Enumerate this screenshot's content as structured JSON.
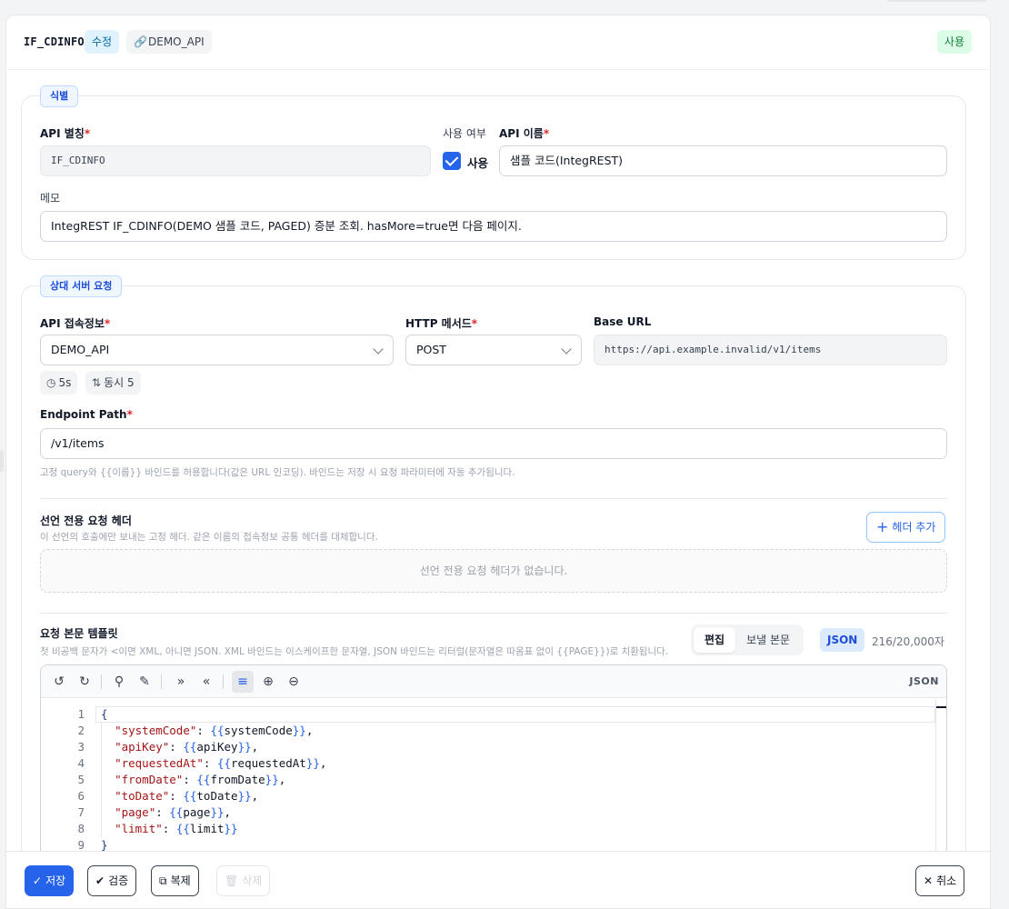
{
  "header": {
    "api_code": "IF_CDINFO",
    "mode_badge": "수정",
    "connection_badge": "DEMO_API",
    "status_badge": "사용"
  },
  "identify": {
    "tag": "식별",
    "alias_label": "API 별칭",
    "alias_value": "IF_CDINFO",
    "use_label": "사용 여부",
    "use_checkbox_label": "사용",
    "use_checked": true,
    "name_label": "API 이름",
    "name_value": "샘플 코드(IntegREST)",
    "memo_label": "메모",
    "memo_value": "IntegREST IF_CDINFO(DEMO 샘플 코드, PAGED) 증분 조회. hasMore=true면 다음 페이지."
  },
  "request": {
    "tag": "상대 서버 요청",
    "conn_label": "API 접속정보",
    "conn_value": "DEMO_API",
    "method_label": "HTTP 메서드",
    "method_value": "POST",
    "base_label": "Base URL",
    "base_value": "https://api.example.invalid/v1/items",
    "timeout_chip": "5s",
    "concurrency_chip": "동시 5",
    "endpoint_label": "Endpoint Path",
    "endpoint_value": "/v1/items",
    "endpoint_hint": "고정 query와 {{이름}} 바인드를 허용합니다(값은 URL 인코딩). 바인드는 저장 시 요청 파라미터에 자동 추가됩니다.",
    "headers_title": "선언 전용 요청 헤더",
    "headers_hint": "이 선언의 호출에만 보내는 고정 헤더. 같은 이름의 접속정보 공통 헤더를 대체합니다.",
    "add_header_label": "헤더 추가",
    "headers_empty": "선언 전용 요청 헤더가 없습니다.",
    "body_title": "요청 본문 템플릿",
    "body_hint": "첫 비공백 문자가 <이면 XML, 아니면 JSON. XML 바인드는 이스케이프한 문자열, JSON 바인드는 리터럴(문자열은 따옴표 없이 {{PAGE}})로 치환됩니다.",
    "tab_edit": "편집",
    "tab_preview": "보낼 본문",
    "format_pill": "JSON",
    "char_count": "216/20,000자",
    "editor_lang": "JSON"
  },
  "code_lines": [
    {
      "n": "1",
      "brace": "{"
    },
    {
      "n": "2",
      "key": "\"systemCode\"",
      "var": "systemCode",
      "comma": ","
    },
    {
      "n": "3",
      "key": "\"apiKey\"",
      "var": "apiKey",
      "comma": ","
    },
    {
      "n": "4",
      "key": "\"requestedAt\"",
      "var": "requestedAt",
      "comma": ","
    },
    {
      "n": "5",
      "key": "\"fromDate\"",
      "var": "fromDate",
      "comma": ","
    },
    {
      "n": "6",
      "key": "\"toDate\"",
      "var": "toDate",
      "comma": ","
    },
    {
      "n": "7",
      "key": "\"page\"",
      "var": "page",
      "comma": ","
    },
    {
      "n": "8",
      "key": "\"limit\"",
      "var": "limit",
      "comma": ""
    },
    {
      "n": "9",
      "brace": "}"
    }
  ],
  "footer": {
    "save": "저장",
    "validate": "검증",
    "copy": "복제",
    "delete": "삭제",
    "cancel": "취소"
  },
  "colors": {
    "accent": "#2563eb",
    "use_badge_bg": "#dcfce7",
    "required": "#dc2626"
  }
}
